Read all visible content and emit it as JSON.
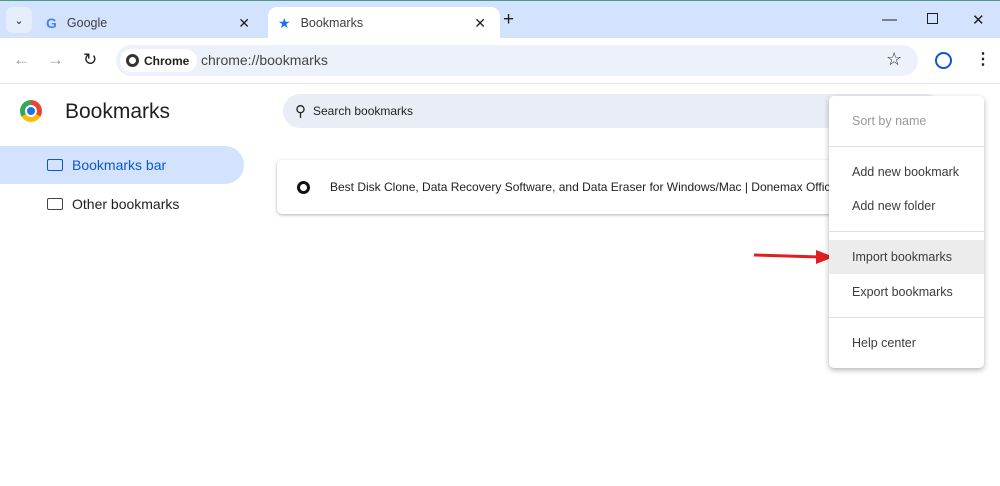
{
  "tabs": [
    {
      "title": "Google",
      "icon": "google-g-icon",
      "active": false
    },
    {
      "title": "Bookmarks",
      "icon": "star-icon",
      "active": true
    }
  ],
  "toolbar": {
    "chip_label": "Chrome",
    "url": "chrome://bookmarks"
  },
  "page": {
    "title": "Bookmarks",
    "search_placeholder": "Search bookmarks"
  },
  "sidebar": {
    "items": [
      {
        "label": "Bookmarks bar",
        "selected": true
      },
      {
        "label": "Other bookmarks",
        "selected": false
      }
    ]
  },
  "bookmarks": [
    {
      "title": "Best Disk Clone, Data Recovery Software, and Data Eraser for Windows/Mac | Donemax Official"
    }
  ],
  "menu": {
    "items": [
      {
        "label": "Sort by name",
        "disabled": true
      },
      {
        "label": "Add new bookmark"
      },
      {
        "label": "Add new folder"
      },
      {
        "label": "Import bookmarks",
        "highlighted": true
      },
      {
        "label": "Export bookmarks"
      },
      {
        "label": "Help center"
      }
    ]
  },
  "colors": {
    "accent": "#0b57d0",
    "tabstrip": "#d3e3fd",
    "annotation_arrow": "#e02020"
  }
}
